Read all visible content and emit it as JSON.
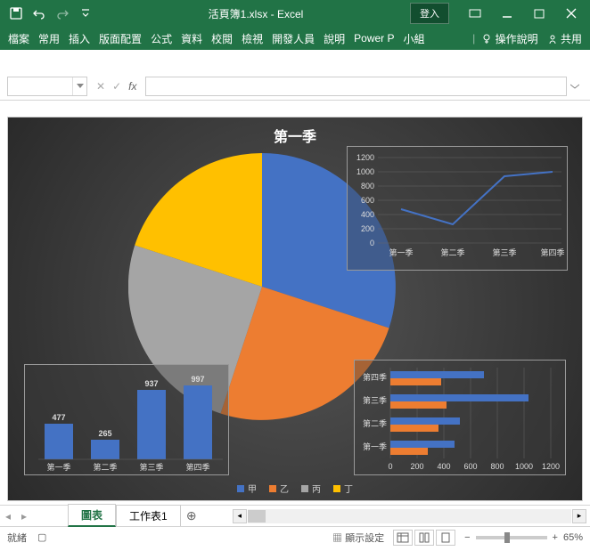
{
  "titlebar": {
    "filename": "活頁簿1.xlsx - Excel",
    "login": "登入"
  },
  "ribbon": {
    "tabs": [
      "檔案",
      "常用",
      "插入",
      "版面配置",
      "公式",
      "資料",
      "校閱",
      "檢視",
      "開發人員",
      "說明",
      "Power P",
      "小組"
    ],
    "help": "操作說明",
    "share": "共用"
  },
  "formula": {
    "fx": "fx"
  },
  "chart": {
    "title": "第一季",
    "legend_items": [
      "甲",
      "乙",
      "丙",
      "丁"
    ],
    "colors": {
      "a": "#4472C4",
      "b": "#ED7D31",
      "c": "#A5A5A5",
      "d": "#FFC000"
    },
    "quarters": [
      "第一季",
      "第二季",
      "第三季",
      "第四季"
    ]
  },
  "chart_data": [
    {
      "type": "pie",
      "title": "第一季",
      "categories": [
        "甲",
        "乙",
        "丙",
        "丁"
      ],
      "values": [
        32,
        28,
        22,
        18
      ]
    },
    {
      "type": "line",
      "categories": [
        "第一季",
        "第二季",
        "第三季",
        "第四季"
      ],
      "values": [
        477,
        265,
        937,
        997
      ],
      "ylim": [
        0,
        1200
      ],
      "yticks": [
        0,
        200,
        400,
        600,
        800,
        1000,
        1200
      ]
    },
    {
      "type": "bar",
      "categories": [
        "第一季",
        "第二季",
        "第三季",
        "第四季"
      ],
      "values": [
        477,
        265,
        937,
        997
      ],
      "data_labels": [
        "477",
        "265",
        "937",
        "997"
      ]
    },
    {
      "type": "bar-horizontal",
      "categories": [
        "第一季",
        "第二季",
        "第三季",
        "第四季"
      ],
      "series": [
        {
          "name": "甲",
          "values": [
            477,
            520,
            1030,
            700
          ]
        },
        {
          "name": "乙",
          "values": [
            280,
            360,
            420,
            380
          ]
        }
      ],
      "xlim": [
        0,
        1200
      ],
      "xticks": [
        0,
        200,
        400,
        600,
        800,
        1000,
        1200
      ]
    }
  ],
  "sheets": {
    "active": "圖表",
    "other": "工作表1"
  },
  "status": {
    "ready": "就緒",
    "display": "顯示設定",
    "zoom": "65%"
  }
}
